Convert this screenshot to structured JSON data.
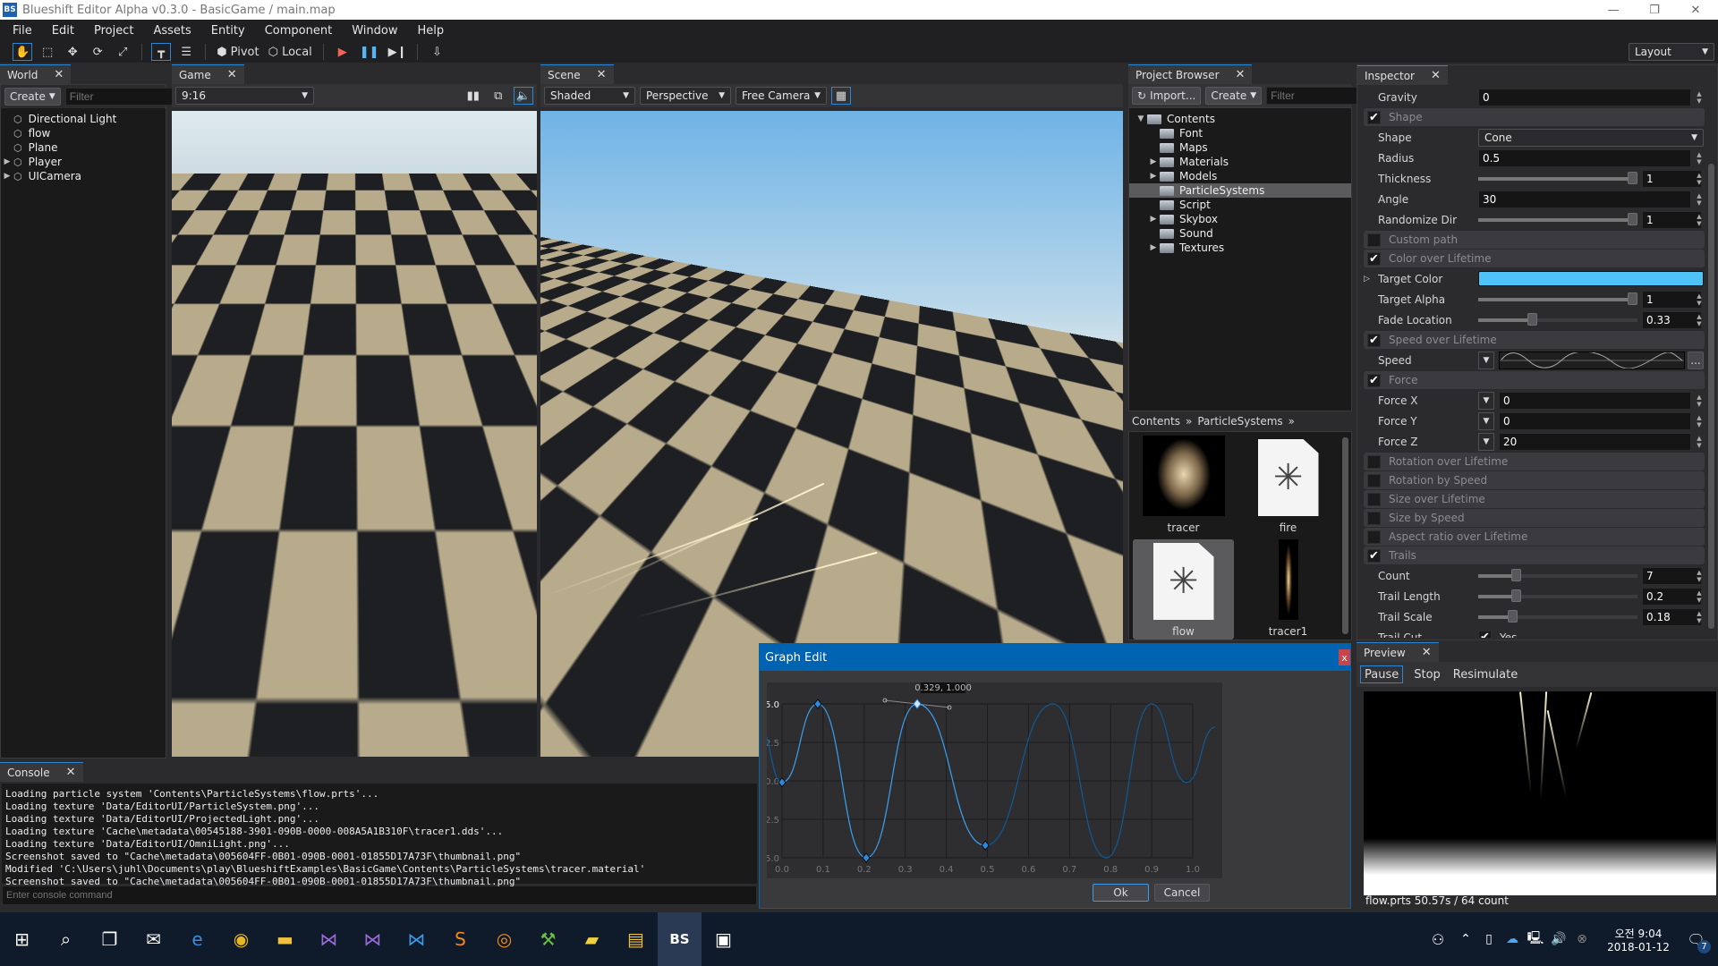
{
  "window": {
    "title": "Blueshift Editor Alpha v0.3.0 - BasicGame / main.map",
    "logo": "BS",
    "minimize": "—",
    "restore": "❐",
    "close": "✕"
  },
  "menu": [
    "File",
    "Edit",
    "Project",
    "Assets",
    "Entity",
    "Component",
    "Window",
    "Help"
  ],
  "toolbar": {
    "pivot": "Pivot",
    "local": "Local",
    "layout": "Layout",
    "icons": [
      "hand-icon",
      "rect-select-icon",
      "move-icon",
      "rotate-icon",
      "scale-icon",
      "snap-icon",
      "align-icon",
      "play-icon",
      "pause-icon",
      "step-icon",
      "build-icon"
    ]
  },
  "world": {
    "tab": "World",
    "create": "Create",
    "filter_placeholder": "Filter",
    "items": [
      {
        "label": "Directional Light",
        "expandable": false
      },
      {
        "label": "flow",
        "expandable": false
      },
      {
        "label": "Plane",
        "expandable": false
      },
      {
        "label": "Player",
        "expandable": true
      },
      {
        "label": "UICamera",
        "expandable": true
      }
    ]
  },
  "game": {
    "tab": "Game",
    "aspect": "9:16",
    "icons": [
      "stats-icon",
      "maximize-icon",
      "audio-icon"
    ]
  },
  "scene": {
    "tab": "Scene",
    "render_mode": "Shaded",
    "projection": "Perspective",
    "camera": "Free Camera",
    "icons": [
      "grid-icon"
    ]
  },
  "project": {
    "tab": "Project Browser",
    "import": "Import...",
    "create": "Create",
    "filter_placeholder": "Filter",
    "tree": [
      {
        "label": "Contents",
        "depth": 0,
        "expanded": true
      },
      {
        "label": "Font",
        "depth": 1
      },
      {
        "label": "Maps",
        "depth": 1
      },
      {
        "label": "Materials",
        "depth": 1,
        "expandable": true
      },
      {
        "label": "Models",
        "depth": 1,
        "expandable": true
      },
      {
        "label": "ParticleSystems",
        "depth": 1,
        "selected": true
      },
      {
        "label": "Script",
        "depth": 1
      },
      {
        "label": "Skybox",
        "depth": 1,
        "expandable": true
      },
      {
        "label": "Sound",
        "depth": 1
      },
      {
        "label": "Textures",
        "depth": 1,
        "expandable": true
      }
    ],
    "breadcrumb": [
      "Contents",
      "ParticleSystems"
    ],
    "assets": [
      {
        "label": "tracer",
        "kind": "texture"
      },
      {
        "label": "fire",
        "kind": "particle"
      },
      {
        "label": "flow",
        "kind": "particle",
        "selected": true
      },
      {
        "label": "tracer1",
        "kind": "streak"
      }
    ]
  },
  "inspector": {
    "tab": "Inspector",
    "rows": [
      {
        "type": "field",
        "label": "Gravity",
        "value": "0"
      },
      {
        "type": "header",
        "label": "Shape",
        "checked": true
      },
      {
        "type": "dropdown",
        "label": "Shape",
        "value": "Cone"
      },
      {
        "type": "field",
        "label": "Radius",
        "value": "0.5"
      },
      {
        "type": "slider",
        "label": "Thickness",
        "value": "1",
        "fraction": 1.0
      },
      {
        "type": "field",
        "label": "Angle",
        "value": "30"
      },
      {
        "type": "slider",
        "label": "Randomize Dir",
        "value": "1",
        "fraction": 1.0
      },
      {
        "type": "header",
        "label": "Custom path",
        "checked": false
      },
      {
        "type": "header",
        "label": "Color over Lifetime",
        "checked": true
      },
      {
        "type": "color",
        "label": "Target Color",
        "value": "#4fc3f7"
      },
      {
        "type": "slider",
        "label": "Target Alpha",
        "value": "1",
        "fraction": 1.0
      },
      {
        "type": "slider",
        "label": "Fade Location",
        "value": "0.33",
        "fraction": 0.33
      },
      {
        "type": "header",
        "label": "Speed over Lifetime",
        "checked": true
      },
      {
        "type": "curve",
        "label": "Speed",
        "more": "..."
      },
      {
        "type": "header",
        "label": "Force",
        "checked": true
      },
      {
        "type": "ddfield",
        "label": "Force X",
        "value": "0"
      },
      {
        "type": "ddfield",
        "label": "Force Y",
        "value": "0"
      },
      {
        "type": "ddfield",
        "label": "Force Z",
        "value": "20"
      },
      {
        "type": "header",
        "label": "Rotation over Lifetime",
        "checked": false
      },
      {
        "type": "header",
        "label": "Rotation by Speed",
        "checked": false
      },
      {
        "type": "header",
        "label": "Size over Lifetime",
        "checked": false
      },
      {
        "type": "header",
        "label": "Size by Speed",
        "checked": false
      },
      {
        "type": "header",
        "label": "Aspect ratio over Lifetime",
        "checked": false
      },
      {
        "type": "header",
        "label": "Trails",
        "checked": true
      },
      {
        "type": "slider",
        "label": "Count",
        "value": "7",
        "fraction": 0.22
      },
      {
        "type": "slider",
        "label": "Trail Length",
        "value": "0.2",
        "fraction": 0.22
      },
      {
        "type": "slider",
        "label": "Trail Scale",
        "value": "0.18",
        "fraction": 0.2
      },
      {
        "type": "check",
        "label": "Trail Cut",
        "value": "Yes",
        "checked": true
      }
    ]
  },
  "preview": {
    "tab": "Preview",
    "buttons": [
      "Pause",
      "Stop",
      "Resimulate"
    ],
    "status": "flow.prts 50.57s / 64 count"
  },
  "console": {
    "tab": "Console",
    "lines": [
      "Loading particle system 'Contents\\ParticleSystems\\flow.prts'...",
      "Loading texture 'Data/EditorUI/ParticleSystem.png'...",
      "Loading texture 'Data/EditorUI/ProjectedLight.png'...",
      "Loading texture 'Cache\\metadata\\00545188-3901-090B-0000-008A5A1B310F\\tracer1.dds'...",
      "Loading texture 'Data/EditorUI/OmniLight.png'...",
      "Screenshot saved to \"Cache\\metadata\\005604FF-0B01-090B-0001-01855D17A73F\\thumbnail.png\"",
      "Modified 'C:\\Users\\juhl\\Documents\\play\\BlueshiftExamples\\BasicGame\\Contents\\ParticleSystems\\tracer.material'",
      "Screenshot saved to \"Cache\\metadata\\005604FF-0B01-090B-0001-01855D17A73F\\thumbnail.png\""
    ],
    "input_placeholder": "Enter console command"
  },
  "graph_dialog": {
    "title": "Graph Edit",
    "close": "x",
    "ok": "Ok",
    "cancel": "Cancel",
    "tooltip": "0.329, 1.000"
  },
  "chart_data": {
    "type": "line",
    "xlim": [
      0,
      1
    ],
    "ylim": [
      -5,
      5
    ],
    "grid": true,
    "x_ticks": [
      "0.0",
      "0.1",
      "0.2",
      "0.3",
      "0.4",
      "0.5",
      "0.6",
      "0.7",
      "0.8",
      "0.9",
      "1.0"
    ],
    "y_ticks": [
      "5.0",
      "2.5",
      "0.0",
      "-2.5",
      "-5.0"
    ],
    "keys": [
      [
        0.0,
        -0.1
      ],
      [
        0.087,
        5.0
      ],
      [
        0.205,
        -5.0
      ],
      [
        0.329,
        5.0
      ],
      [
        0.495,
        -4.2
      ]
    ],
    "selected_key": 3,
    "extrapolated_before": [
      [
        -0.055,
        3.5
      ]
    ],
    "extrapolated_after": [
      [
        0.66,
        5.0
      ],
      [
        0.79,
        -5.0
      ],
      [
        0.9,
        5.0
      ],
      [
        0.985,
        -0.1
      ],
      [
        1.055,
        3.5
      ]
    ],
    "colors": {
      "curve": "#3aa0f0",
      "extrapolated": "#0e5a96"
    }
  },
  "taskbar": {
    "time": "오전 9:04",
    "date": "2018-01-12",
    "notifications": "7",
    "bs": "BS"
  }
}
